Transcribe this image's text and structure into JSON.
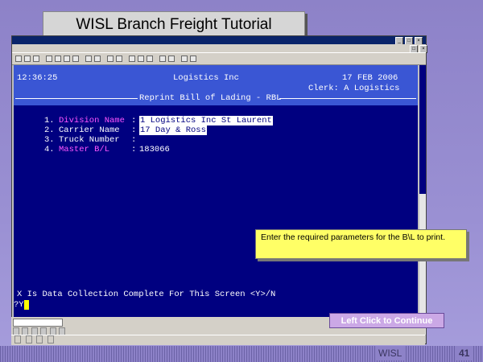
{
  "slide": {
    "title": "WISL Branch Freight Tutorial",
    "tooltip": "Enter the required parameters for the B\\L to print.",
    "continue_label": "Left Click to Continue",
    "footer_brand": "WISL",
    "page_number": "41"
  },
  "terminal": {
    "time": "12:36:25",
    "company": "Logistics Inc",
    "date": "17 FEB 2006",
    "clerk": "Clerk: A Logistics",
    "screen_title": "Reprint Bill of Lading - RBL",
    "fields": [
      {
        "num": "1.",
        "label": "Division Name",
        "value": "1 Logistics Inc St Laurent"
      },
      {
        "num": "2.",
        "label": "Carrier Name",
        "value": "17 Day & Ross"
      },
      {
        "num": "3.",
        "label": "Truck Number",
        "value": ""
      },
      {
        "num": "4.",
        "label": "Master B/L",
        "value": "183066"
      }
    ],
    "prompt": "X Is Data Collection Complete For This Screen <Y>/N",
    "input": "?Y"
  },
  "window": {
    "minimize_glyph": "_",
    "maximize_glyph": "□",
    "close_glyph": "×"
  }
}
